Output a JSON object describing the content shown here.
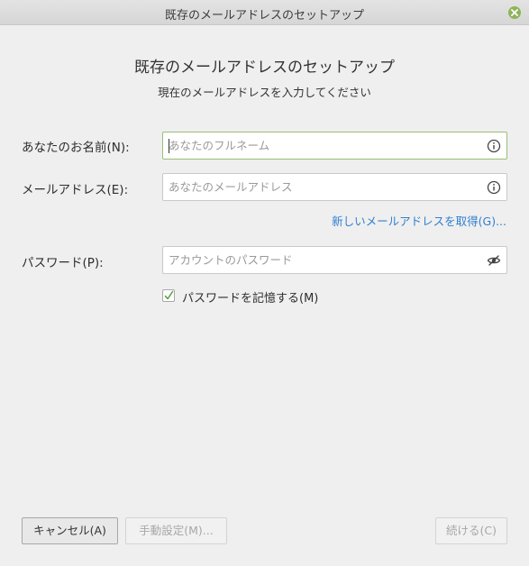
{
  "window": {
    "title": "既存のメールアドレスのセットアップ"
  },
  "header": {
    "title": "既存のメールアドレスのセットアップ",
    "subtitle": "現在のメールアドレスを入力してください"
  },
  "form": {
    "name": {
      "label": "あなたのお名前(N):",
      "placeholder": "あなたのフルネーム",
      "value": "",
      "icon": "info-icon"
    },
    "email": {
      "label": "メールアドレス(E):",
      "placeholder": "あなたのメールアドレス",
      "value": "",
      "icon": "info-icon"
    },
    "get_new_link": "新しいメールアドレスを取得(G)...",
    "password": {
      "label": "パスワード(P):",
      "placeholder": "アカウントのパスワード",
      "value": "",
      "icon": "eye-slash-icon"
    },
    "remember": {
      "label": "パスワードを記憶する(M)",
      "checked": true
    }
  },
  "buttons": {
    "cancel": "キャンセル(A)",
    "manual": "手動設定(M)...",
    "continue": "続ける(C)"
  },
  "colors": {
    "link": "#2f7fd2",
    "focus": "#9cbd76",
    "close": "#8fb35b"
  }
}
